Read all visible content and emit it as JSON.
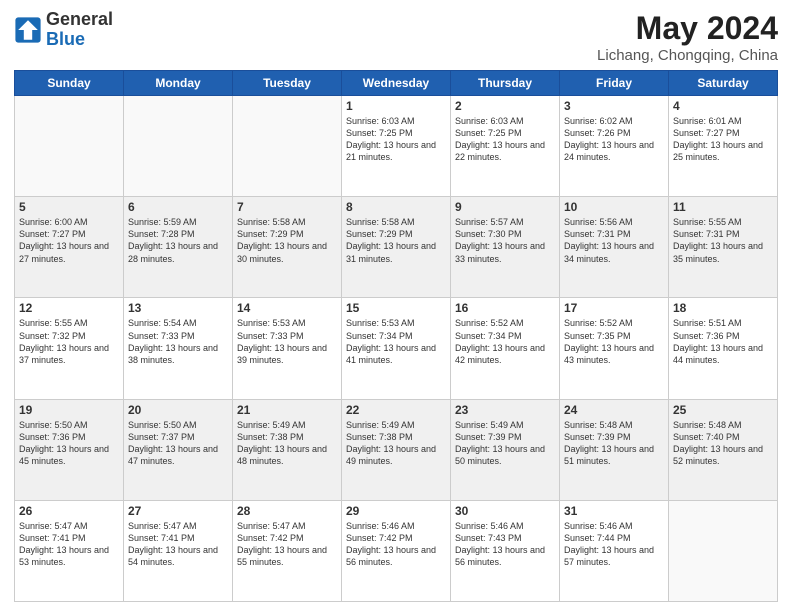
{
  "logo": {
    "line1": "General",
    "line2": "Blue"
  },
  "title": "May 2024",
  "location": "Lichang, Chongqing, China",
  "days_of_week": [
    "Sunday",
    "Monday",
    "Tuesday",
    "Wednesday",
    "Thursday",
    "Friday",
    "Saturday"
  ],
  "weeks": [
    {
      "shaded": false,
      "days": [
        {
          "num": "",
          "info": ""
        },
        {
          "num": "",
          "info": ""
        },
        {
          "num": "",
          "info": ""
        },
        {
          "num": "1",
          "info": "Sunrise: 6:03 AM\nSunset: 7:25 PM\nDaylight: 13 hours and 21 minutes."
        },
        {
          "num": "2",
          "info": "Sunrise: 6:03 AM\nSunset: 7:25 PM\nDaylight: 13 hours and 22 minutes."
        },
        {
          "num": "3",
          "info": "Sunrise: 6:02 AM\nSunset: 7:26 PM\nDaylight: 13 hours and 24 minutes."
        },
        {
          "num": "4",
          "info": "Sunrise: 6:01 AM\nSunset: 7:27 PM\nDaylight: 13 hours and 25 minutes."
        }
      ]
    },
    {
      "shaded": true,
      "days": [
        {
          "num": "5",
          "info": "Sunrise: 6:00 AM\nSunset: 7:27 PM\nDaylight: 13 hours and 27 minutes."
        },
        {
          "num": "6",
          "info": "Sunrise: 5:59 AM\nSunset: 7:28 PM\nDaylight: 13 hours and 28 minutes."
        },
        {
          "num": "7",
          "info": "Sunrise: 5:58 AM\nSunset: 7:29 PM\nDaylight: 13 hours and 30 minutes."
        },
        {
          "num": "8",
          "info": "Sunrise: 5:58 AM\nSunset: 7:29 PM\nDaylight: 13 hours and 31 minutes."
        },
        {
          "num": "9",
          "info": "Sunrise: 5:57 AM\nSunset: 7:30 PM\nDaylight: 13 hours and 33 minutes."
        },
        {
          "num": "10",
          "info": "Sunrise: 5:56 AM\nSunset: 7:31 PM\nDaylight: 13 hours and 34 minutes."
        },
        {
          "num": "11",
          "info": "Sunrise: 5:55 AM\nSunset: 7:31 PM\nDaylight: 13 hours and 35 minutes."
        }
      ]
    },
    {
      "shaded": false,
      "days": [
        {
          "num": "12",
          "info": "Sunrise: 5:55 AM\nSunset: 7:32 PM\nDaylight: 13 hours and 37 minutes."
        },
        {
          "num": "13",
          "info": "Sunrise: 5:54 AM\nSunset: 7:33 PM\nDaylight: 13 hours and 38 minutes."
        },
        {
          "num": "14",
          "info": "Sunrise: 5:53 AM\nSunset: 7:33 PM\nDaylight: 13 hours and 39 minutes."
        },
        {
          "num": "15",
          "info": "Sunrise: 5:53 AM\nSunset: 7:34 PM\nDaylight: 13 hours and 41 minutes."
        },
        {
          "num": "16",
          "info": "Sunrise: 5:52 AM\nSunset: 7:34 PM\nDaylight: 13 hours and 42 minutes."
        },
        {
          "num": "17",
          "info": "Sunrise: 5:52 AM\nSunset: 7:35 PM\nDaylight: 13 hours and 43 minutes."
        },
        {
          "num": "18",
          "info": "Sunrise: 5:51 AM\nSunset: 7:36 PM\nDaylight: 13 hours and 44 minutes."
        }
      ]
    },
    {
      "shaded": true,
      "days": [
        {
          "num": "19",
          "info": "Sunrise: 5:50 AM\nSunset: 7:36 PM\nDaylight: 13 hours and 45 minutes."
        },
        {
          "num": "20",
          "info": "Sunrise: 5:50 AM\nSunset: 7:37 PM\nDaylight: 13 hours and 47 minutes."
        },
        {
          "num": "21",
          "info": "Sunrise: 5:49 AM\nSunset: 7:38 PM\nDaylight: 13 hours and 48 minutes."
        },
        {
          "num": "22",
          "info": "Sunrise: 5:49 AM\nSunset: 7:38 PM\nDaylight: 13 hours and 49 minutes."
        },
        {
          "num": "23",
          "info": "Sunrise: 5:49 AM\nSunset: 7:39 PM\nDaylight: 13 hours and 50 minutes."
        },
        {
          "num": "24",
          "info": "Sunrise: 5:48 AM\nSunset: 7:39 PM\nDaylight: 13 hours and 51 minutes."
        },
        {
          "num": "25",
          "info": "Sunrise: 5:48 AM\nSunset: 7:40 PM\nDaylight: 13 hours and 52 minutes."
        }
      ]
    },
    {
      "shaded": false,
      "days": [
        {
          "num": "26",
          "info": "Sunrise: 5:47 AM\nSunset: 7:41 PM\nDaylight: 13 hours and 53 minutes."
        },
        {
          "num": "27",
          "info": "Sunrise: 5:47 AM\nSunset: 7:41 PM\nDaylight: 13 hours and 54 minutes."
        },
        {
          "num": "28",
          "info": "Sunrise: 5:47 AM\nSunset: 7:42 PM\nDaylight: 13 hours and 55 minutes."
        },
        {
          "num": "29",
          "info": "Sunrise: 5:46 AM\nSunset: 7:42 PM\nDaylight: 13 hours and 56 minutes."
        },
        {
          "num": "30",
          "info": "Sunrise: 5:46 AM\nSunset: 7:43 PM\nDaylight: 13 hours and 56 minutes."
        },
        {
          "num": "31",
          "info": "Sunrise: 5:46 AM\nSunset: 7:44 PM\nDaylight: 13 hours and 57 minutes."
        },
        {
          "num": "",
          "info": ""
        }
      ]
    }
  ]
}
